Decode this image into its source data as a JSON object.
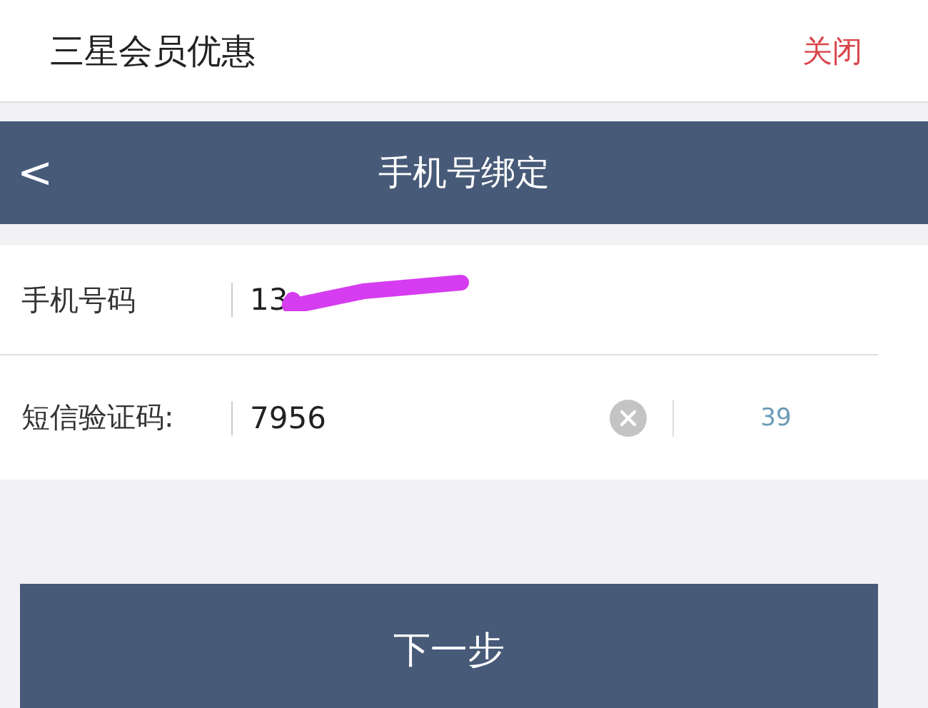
{
  "top_bar": {
    "title": "三星会员优惠",
    "close": "关闭"
  },
  "nav_bar": {
    "back": "<",
    "title": "手机号绑定"
  },
  "form": {
    "rows": [
      {
        "kind": "phone",
        "label": "手机号码",
        "value": "13",
        "redacted": true
      },
      {
        "kind": "code",
        "label": "短信验证码:",
        "value": "7956",
        "countdown": "39"
      }
    ]
  },
  "next_button": "下一步"
}
